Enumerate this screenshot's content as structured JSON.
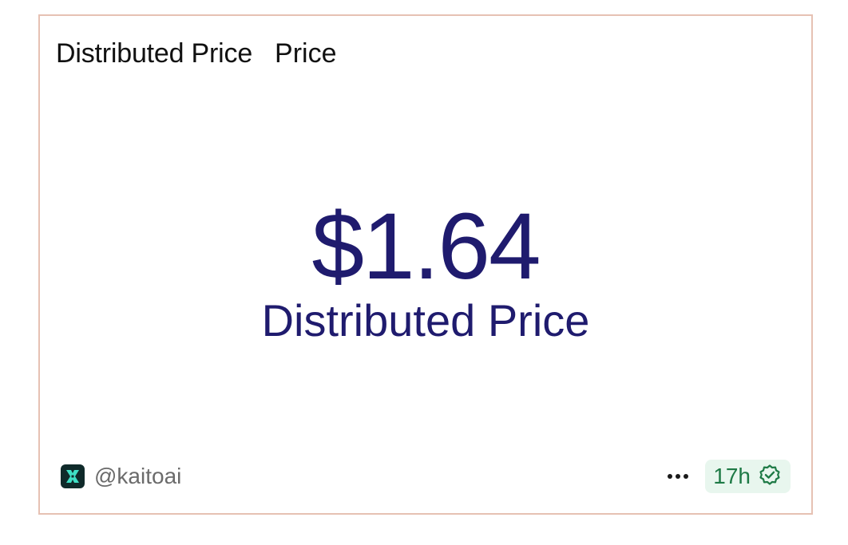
{
  "card": {
    "title": "Distributed Price",
    "subtitle": "Price",
    "metric_value": "$1.64",
    "metric_label": "Distributed Price"
  },
  "footer": {
    "source_handle": "@kaitoai",
    "source_icon": "kaito-logo-icon",
    "more_icon": "more-horizontal-icon",
    "age": "17h",
    "verified_icon": "verified-check-icon"
  },
  "colors": {
    "border": "#e6c1b3",
    "metric": "#1f1b6e",
    "badge_bg": "#e8f6ee",
    "badge_text": "#1e7a46",
    "logo_accent": "#3fe0c6"
  }
}
